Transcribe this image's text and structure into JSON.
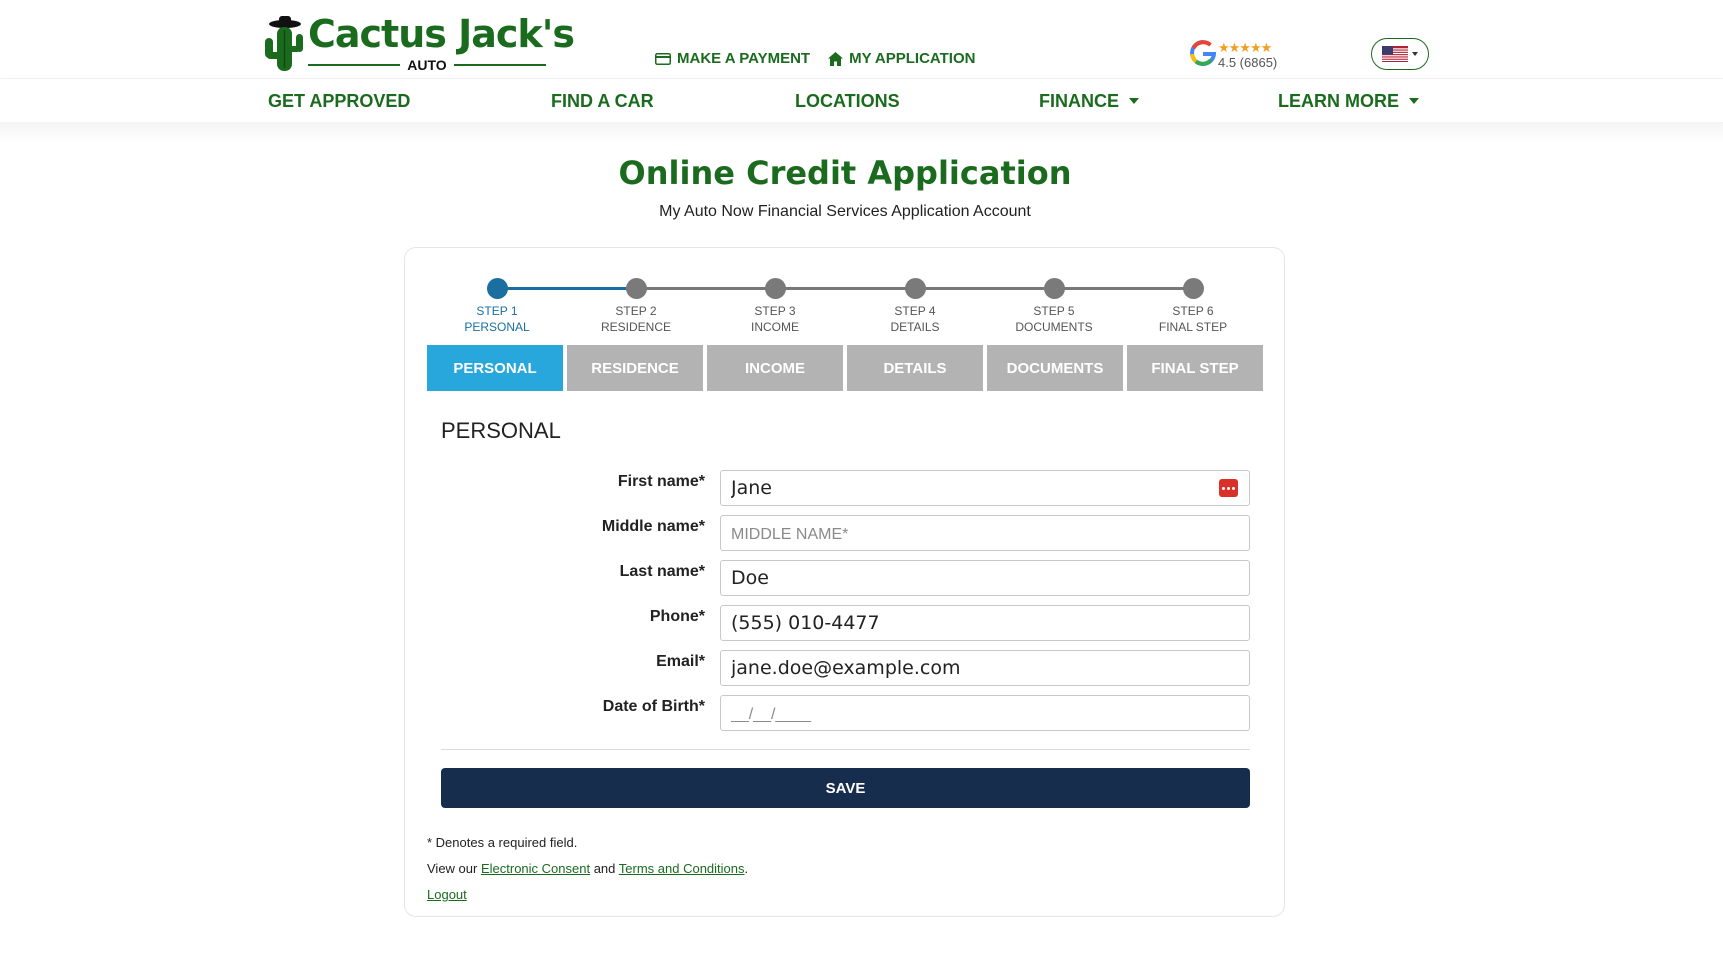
{
  "brand": {
    "name": "Cactus Jack's",
    "sub": "AUTO",
    "color": "#1b6b1f"
  },
  "quicklinks": [
    {
      "label": "MAKE A PAYMENT",
      "icon": "credit-card-icon"
    },
    {
      "label": "MY APPLICATION",
      "icon": "home-icon"
    }
  ],
  "rating": {
    "stars": "★★★★★",
    "score": "4.5 (6865)"
  },
  "language": {
    "icon": "us-flag-icon"
  },
  "nav": [
    {
      "label": "GET APPROVED"
    },
    {
      "label": "FIND A CAR"
    },
    {
      "label": "LOCATIONS"
    },
    {
      "label": "FINANCE",
      "dropdown": true
    },
    {
      "label": "LEARN MORE",
      "dropdown": true
    }
  ],
  "page": {
    "title": "Online Credit Application",
    "subtitle": "My Auto Now Financial Services Application Account"
  },
  "steps": [
    {
      "n": "STEP 1",
      "label": "PERSONAL",
      "active": true
    },
    {
      "n": "STEP 2",
      "label": "RESIDENCE"
    },
    {
      "n": "STEP 3",
      "label": "INCOME"
    },
    {
      "n": "STEP 4",
      "label": "DETAILS"
    },
    {
      "n": "STEP 5",
      "label": "DOCUMENTS"
    },
    {
      "n": "STEP 6",
      "label": "FINAL STEP"
    }
  ],
  "tabs": [
    {
      "label": "PERSONAL",
      "active": true
    },
    {
      "label": "RESIDENCE"
    },
    {
      "label": "INCOME"
    },
    {
      "label": "DETAILS"
    },
    {
      "label": "DOCUMENTS"
    },
    {
      "label": "FINAL STEP"
    }
  ],
  "form": {
    "section": "PERSONAL",
    "fields": {
      "first": {
        "label": "First name*",
        "value": "Jane",
        "placeholder": ""
      },
      "middle": {
        "label": "Middle name*",
        "value": "",
        "placeholder": "MIDDLE NAME*"
      },
      "last": {
        "label": "Last name*",
        "value": "Doe",
        "placeholder": ""
      },
      "phone": {
        "label": "Phone*",
        "value": "(555) 010-4477",
        "placeholder": ""
      },
      "email": {
        "label": "Email*",
        "value": "jane.doe@example.com",
        "placeholder": ""
      },
      "dob": {
        "label": "Date of Birth*",
        "value": "",
        "placeholder": "__/__/____"
      }
    },
    "save_label": "SAVE"
  },
  "notes": {
    "required": "* Denotes a required field.",
    "view_prefix": "View our ",
    "consent_link": "Electronic Consent",
    "and": " and ",
    "terms_link": "Terms and Conditions",
    "period": ".",
    "logout": "Logout"
  },
  "colors": {
    "green": "#1b6b1f",
    "tab_active": "#27a7dc",
    "tab_inactive": "#b3b3b3",
    "save": "#172d4d",
    "step_active": "#1a6fa0"
  }
}
